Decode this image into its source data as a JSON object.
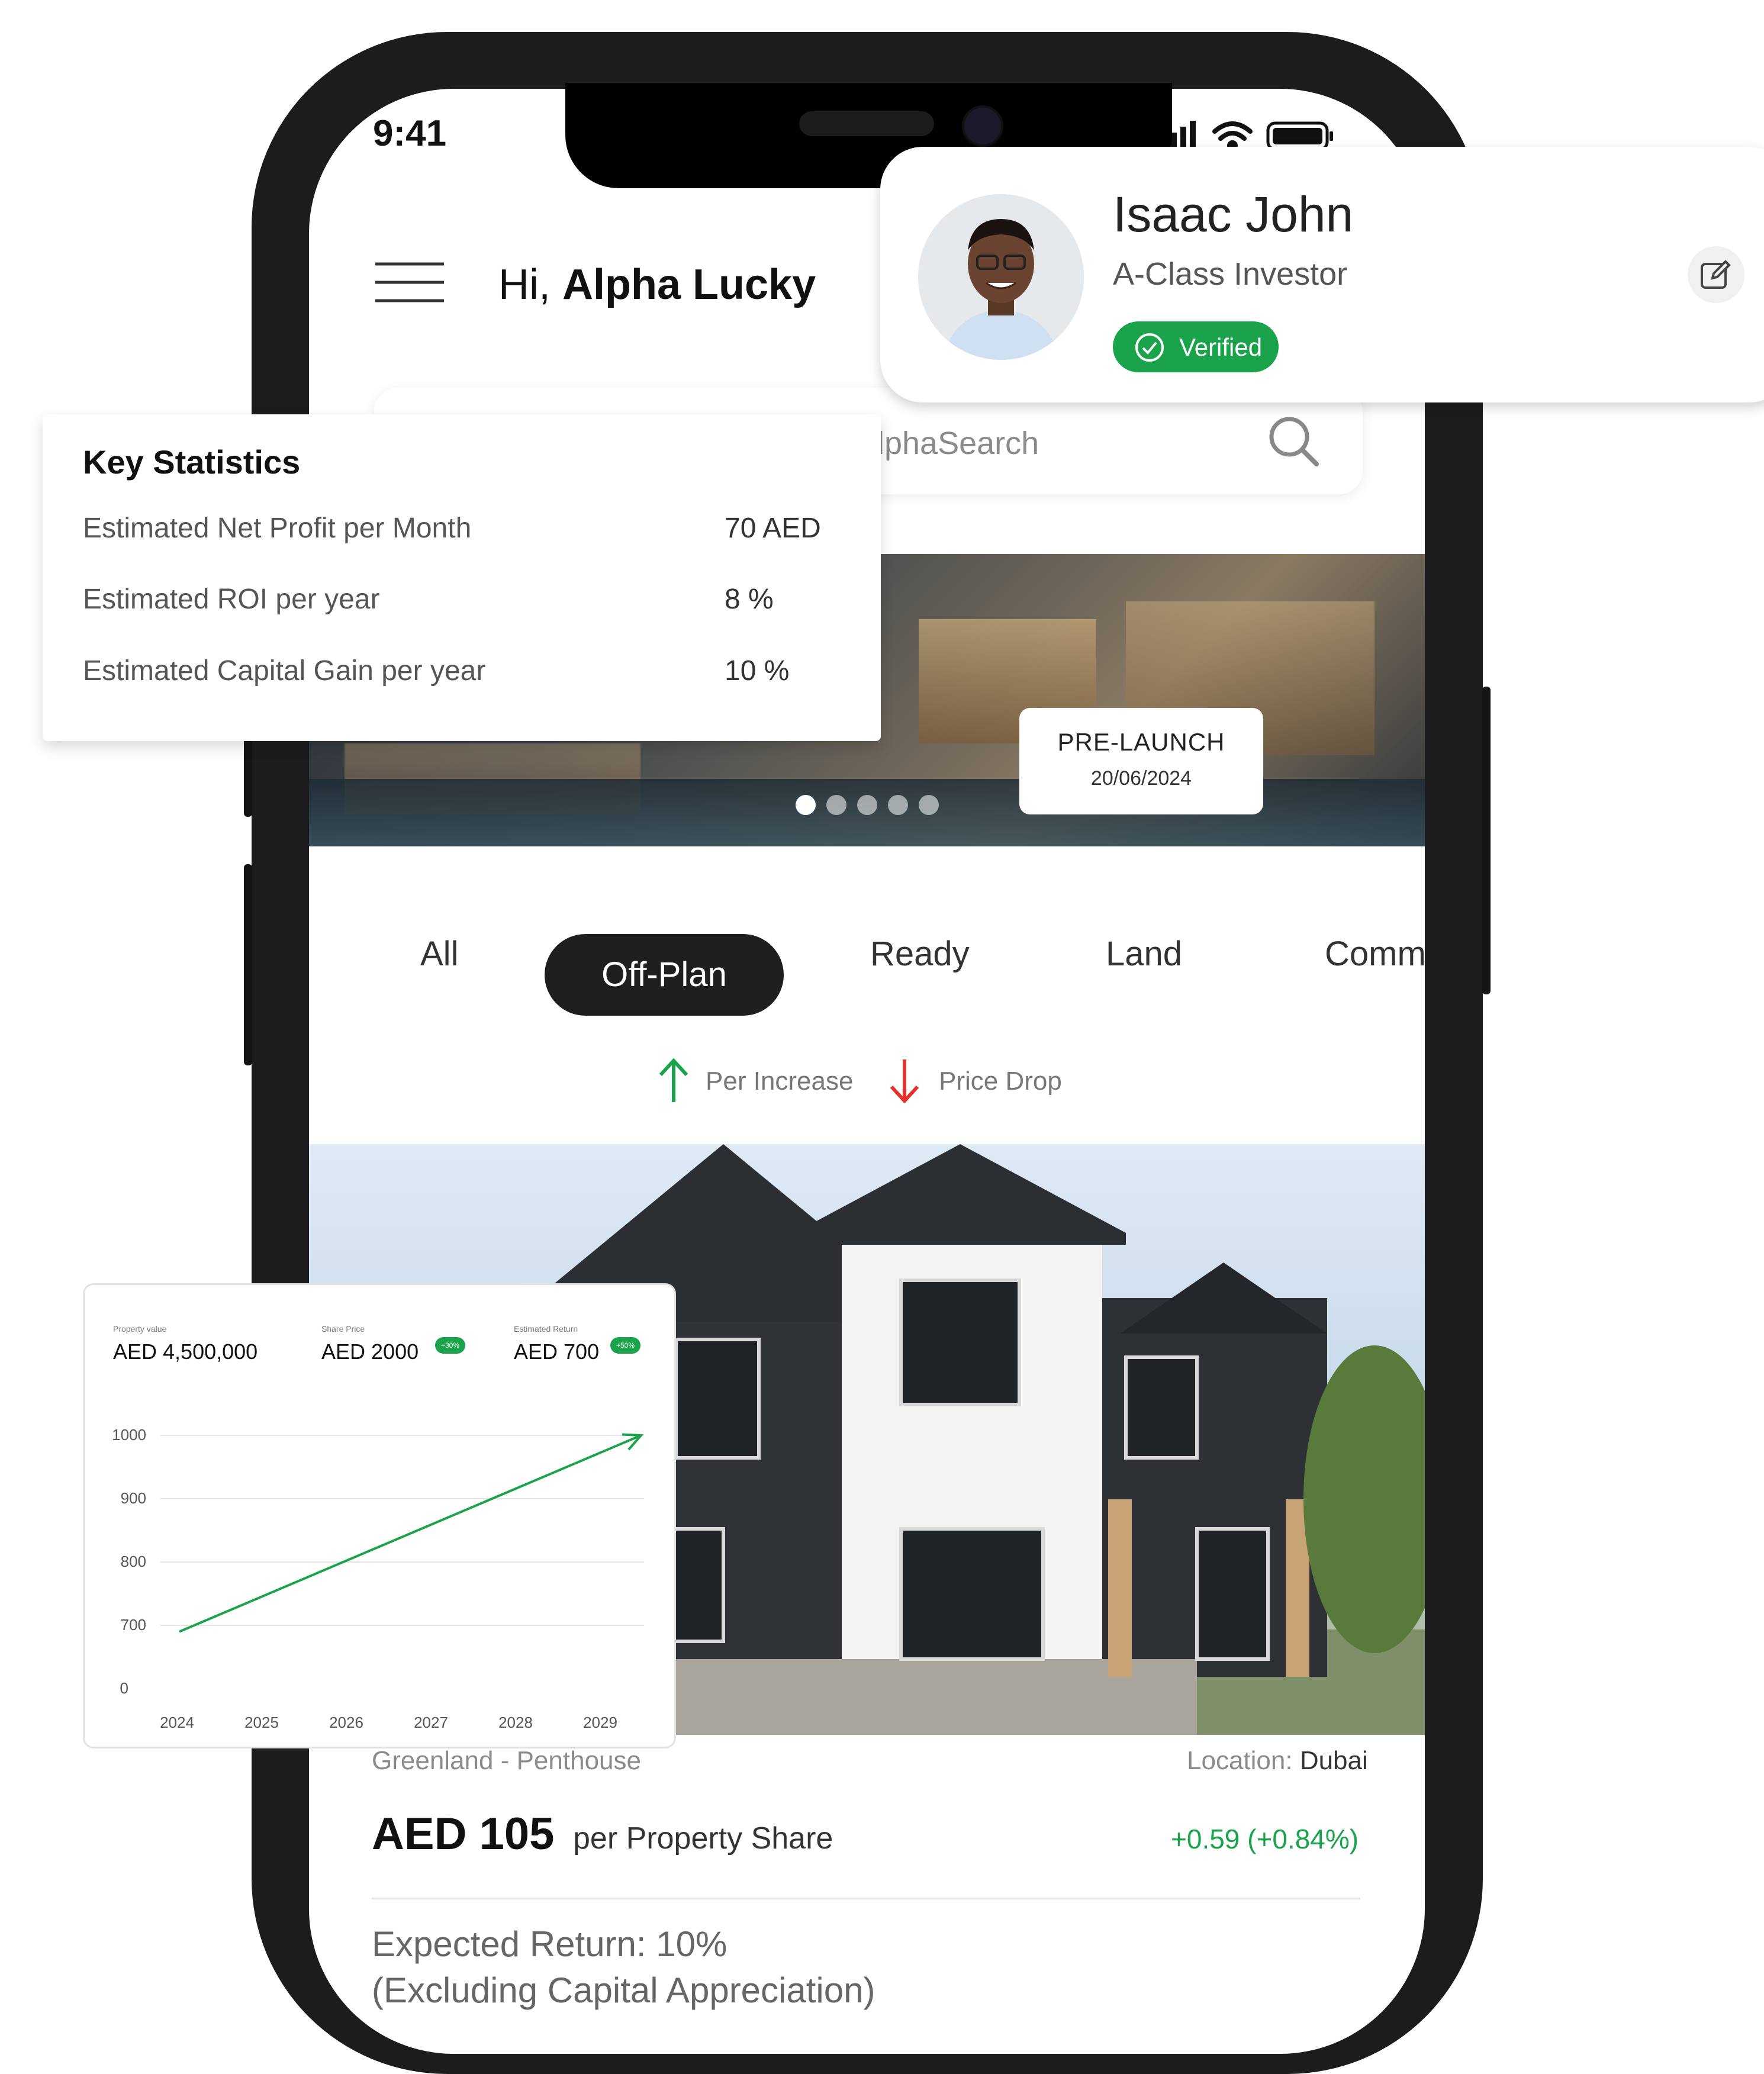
{
  "status_bar": {
    "time": "9:41"
  },
  "header": {
    "greeting_prefix": "Hi,",
    "greeting_name": "Alpha Lucky"
  },
  "search": {
    "placeholder": "lphaSearch"
  },
  "banner": {
    "badge_title": "PRE-LAUNCH",
    "badge_date": "20/06/2024",
    "dots": 5,
    "active_dot": 0
  },
  "tabs": [
    {
      "label": "All",
      "active": false
    },
    {
      "label": "Off-Plan",
      "active": true
    },
    {
      "label": "Ready",
      "active": false
    },
    {
      "label": "Land",
      "active": false
    },
    {
      "label": "Comm",
      "active": false
    }
  ],
  "legend": {
    "increase": "Per Increase",
    "drop": "Price Drop"
  },
  "listing": {
    "name": "Greenland - Penthouse",
    "location_label": "Location:",
    "location_value": "Dubai",
    "price": "AED 105",
    "price_unit": "per Property Share",
    "change": "+0.59 (+0.84%)",
    "return_line1": "Expected Return:   10%",
    "return_line2": "(Excluding Capital Appreciation)"
  },
  "profile": {
    "name": "Isaac John",
    "role": "A-Class Investor",
    "verified": "Verified"
  },
  "key_statistics": {
    "title": "Key Statistics",
    "items": [
      {
        "label": "Estimated Net Profit per Month",
        "value": "70 AED"
      },
      {
        "label": "Estimated ROI per year",
        "value": "8 %"
      },
      {
        "label": "Estimated Capital Gain per year",
        "value": "10 %"
      }
    ]
  },
  "chart_card": {
    "metrics": [
      {
        "label": "Property value",
        "value": "AED 4,500,000",
        "badge": ""
      },
      {
        "label": "Share Price",
        "value": "AED 2000",
        "badge": "+30%"
      },
      {
        "label": "Estimated Return",
        "value": "AED 700",
        "badge": "+50%"
      }
    ]
  },
  "chart_data": {
    "type": "line",
    "x": [
      "2024",
      "2025",
      "2026",
      "2027",
      "2028",
      "2029"
    ],
    "y_ticks": [
      "0",
      "700",
      "800",
      "900",
      "1000"
    ],
    "series": [
      {
        "start": {
          "x": "2024",
          "y": 630
        },
        "end": {
          "x": "2029",
          "y": 1000
        }
      }
    ],
    "colors": {
      "line": "#1aa34a",
      "grid": "#e3e3e3"
    },
    "grid": true,
    "title": "",
    "xlabel": "",
    "ylabel": ""
  },
  "colors": {
    "accent": "#1aa34a",
    "drop": "#e5322d",
    "dark": "#1f1f1f"
  }
}
